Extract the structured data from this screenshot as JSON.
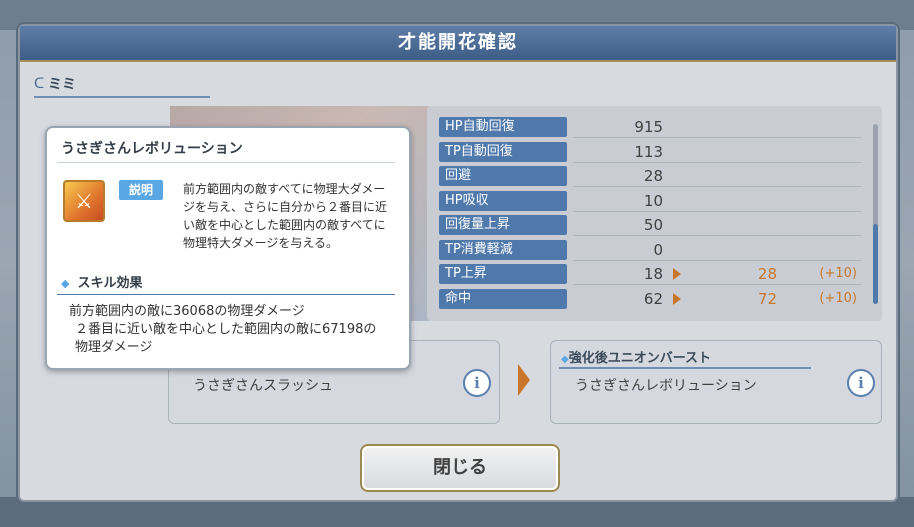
{
  "dialog": {
    "title": "才能開花確認"
  },
  "character": {
    "name": "ミミ"
  },
  "stats": [
    {
      "label": "HP自動回復",
      "value": "915"
    },
    {
      "label": "TP自動回復",
      "value": "113"
    },
    {
      "label": "回避",
      "value": "28"
    },
    {
      "label": "HP吸収",
      "value": "10"
    },
    {
      "label": "回復量上昇",
      "value": "50"
    },
    {
      "label": "TP消費軽減",
      "value": "0"
    },
    {
      "label": "TP上昇",
      "value": "18",
      "new_value": "28",
      "diff": "(+10)"
    },
    {
      "label": "命中",
      "value": "62",
      "new_value": "72",
      "diff": "(+10)"
    }
  ],
  "union_burst": {
    "before_name": "うさぎさんスラッシュ",
    "after_header": "強化後ユニオンバースト",
    "after_name": "うさぎさんレボリューション",
    "info_glyph": "i"
  },
  "close_button": {
    "label": "閉じる"
  },
  "popup": {
    "title": "うさぎさんレボリューション",
    "desc_badge": "説明",
    "description": "前方範囲内の敵すべてに物理大ダメージを与え、さらに自分から２番目に近い敵を中心とした範囲内の敵すべてに物理特大ダメージを与える。",
    "effect_header": "スキル効果",
    "effect_text_1": "前方範囲内の敵に36068の物理ダメージ",
    "effect_text_2": "２番目に近い敵を中心とした範囲内の敵に67198の物理ダメージ"
  },
  "colors": {
    "accent": "#4f79aa",
    "increase": "#c8772a",
    "header": "#3d5c86"
  },
  "icons": [
    "back-arrow-icon",
    "info-icon",
    "skill-icon",
    "arrow-right-icon"
  ]
}
